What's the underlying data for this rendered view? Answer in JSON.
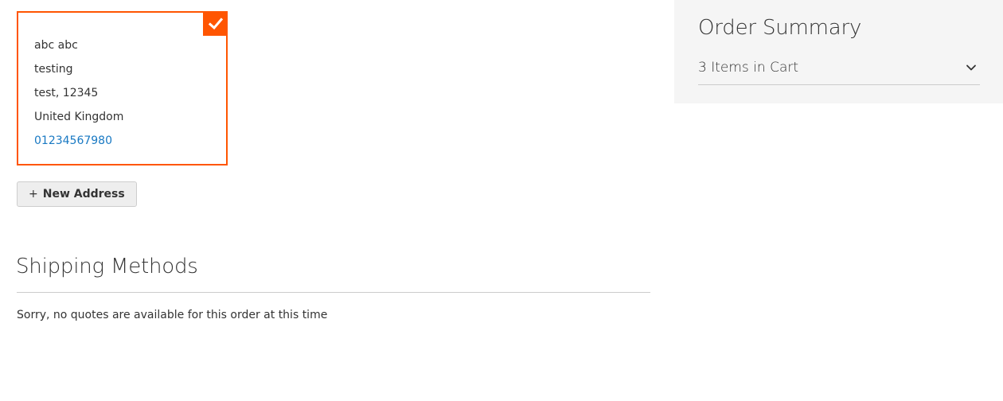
{
  "shipping_address": {
    "name": "abc abc",
    "street": "testing",
    "city_postcode": "test, 12345",
    "country": "United Kingdom",
    "phone": "01234567980"
  },
  "new_address_button": {
    "icon": "+",
    "label": "New Address"
  },
  "shipping_methods": {
    "title": "Shipping Methods",
    "message": "Sorry, no quotes are available for this order at this time"
  },
  "order_summary": {
    "title": "Order Summary",
    "items_in_cart": "3 Items in Cart"
  },
  "colors": {
    "accent": "#ff5501",
    "link": "#1979c3",
    "sidebar_bg": "#f5f5f5"
  },
  "icons": {
    "selected": "checkmark-icon",
    "expand": "chevron-down-icon",
    "add": "plus-icon"
  }
}
